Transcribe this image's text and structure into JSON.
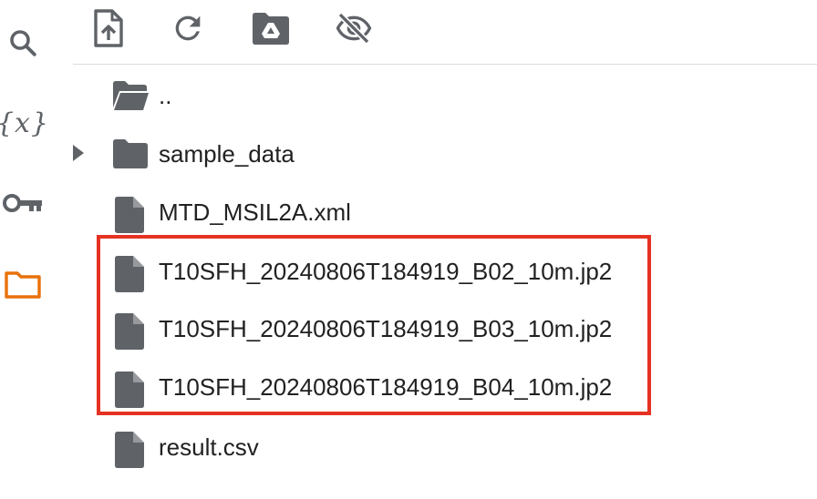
{
  "sidebar": {
    "search_icon": "search-icon",
    "variables_label": "{x}",
    "secrets_icon": "key-icon",
    "files_icon": "folder-icon",
    "active_color": "#e8710a"
  },
  "toolbar": {
    "upload_icon": "upload-file-icon",
    "refresh_icon": "refresh-icon",
    "mount_drive_icon": "drive-folder-icon",
    "toggle_hidden_icon": "eye-off-icon"
  },
  "files": {
    "parent": "..",
    "items": [
      {
        "name": "sample_data",
        "type": "folder"
      },
      {
        "name": "MTD_MSIL2A.xml",
        "type": "file"
      },
      {
        "name": "T10SFH_20240806T184919_B02_10m.jp2",
        "type": "file"
      },
      {
        "name": "T10SFH_20240806T184919_B03_10m.jp2",
        "type": "file"
      },
      {
        "name": "T10SFH_20240806T184919_B04_10m.jp2",
        "type": "file"
      },
      {
        "name": "result.csv",
        "type": "file"
      }
    ]
  },
  "highlight_color": "#e53222"
}
